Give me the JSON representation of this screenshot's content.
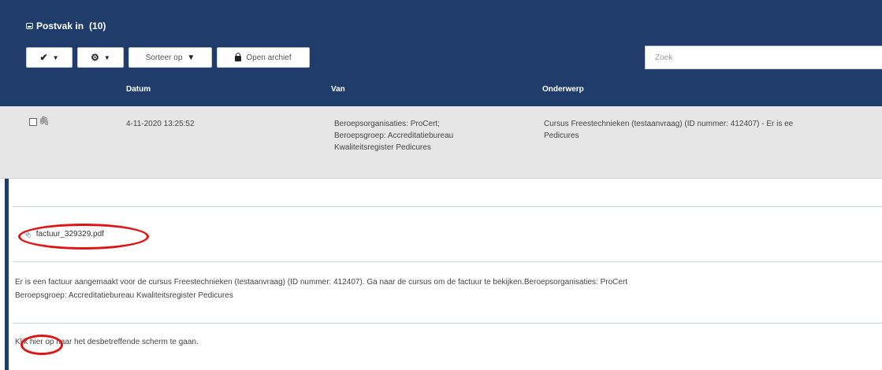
{
  "inbox": {
    "title": "Postvak in",
    "count": "(10)"
  },
  "toolbar": {
    "check_label": "✔",
    "settings_label": "⚙",
    "sort_label": "Sorteer op",
    "archive_label": "Open archief"
  },
  "search": {
    "placeholder": "Zoek"
  },
  "columns": {
    "date": "Datum",
    "from": "Van",
    "subject": "Onderwerp"
  },
  "message": {
    "date": "4-11-2020 13:25:52",
    "from_lines": [
      "Beroepsorganisaties: ProCert;",
      "Beroepsgroep: Accreditatiebureau",
      "Kwaliteitsregister Pedicures"
    ],
    "subject_lines": [
      "Cursus Freestechnieken (testaanvraag) (ID nummer: 412407) - Er is ee",
      "Pedicures"
    ]
  },
  "detail": {
    "attachment": "factuur_329329.pdf",
    "body_lines": [
      "Er is een factuur aangemaakt voor de cursus Freestechnieken (testaanvraag) (ID nummer: 412407). Ga naar de cursus om de factuur te bekijken.Beroepsorganisaties: ProCert",
      "Beroepsgroep: Accreditatiebureau Kwaliteitsregister Pedicures"
    ],
    "link_prefix": "Klik",
    "link_text": "hier op",
    "link_suffix": "naar het desbetreffende scherm te gaan."
  },
  "colors": {
    "header": "#1f3c6b",
    "row": "#e6e6e6",
    "highlight": "#e01414"
  }
}
